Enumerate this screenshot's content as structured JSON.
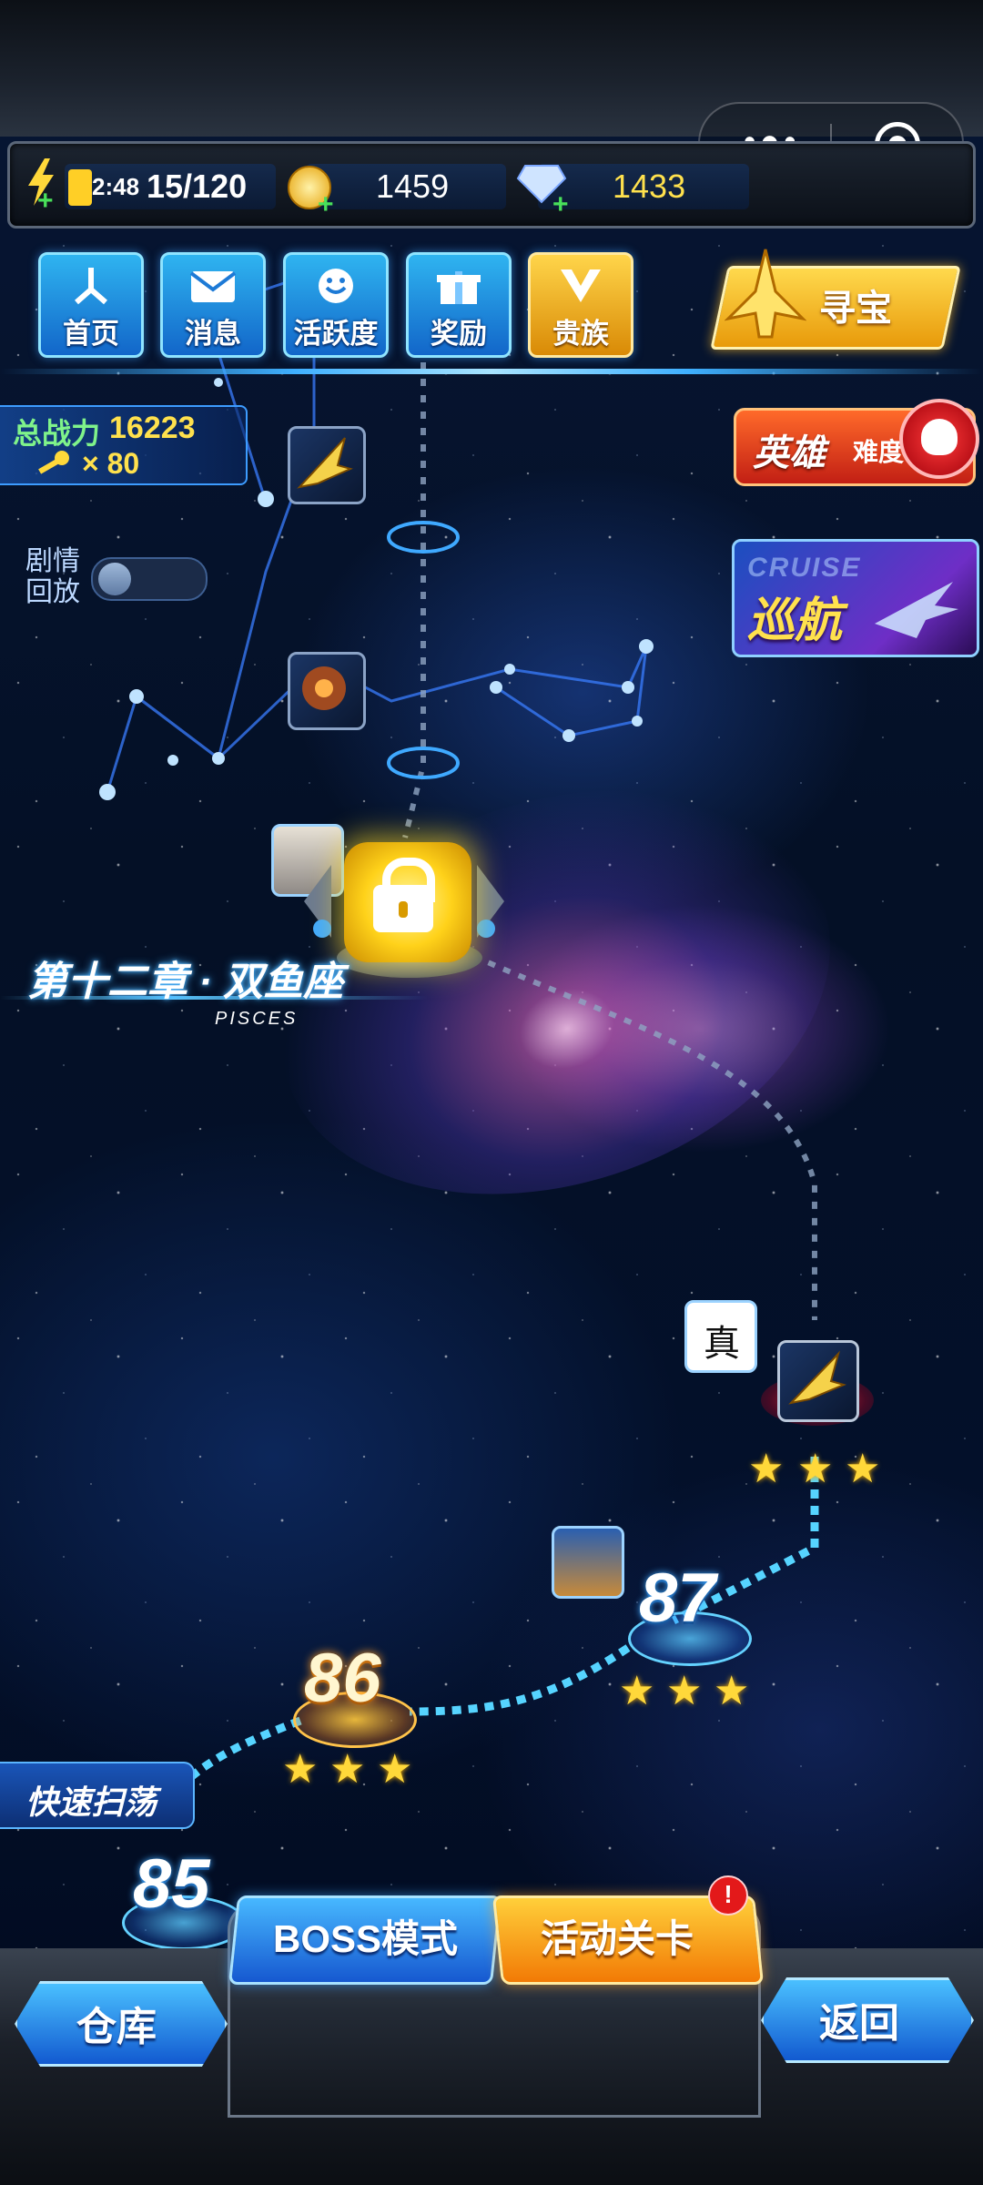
{
  "resources": {
    "energy_timer": "2:48",
    "energy": "15/120",
    "gold": "1459",
    "diamonds": "1433"
  },
  "capsule": {
    "menu_icon": "more-dots-icon",
    "close_icon": "target-icon"
  },
  "nav": [
    {
      "label": "首页",
      "icon": "home-icon"
    },
    {
      "label": "消息",
      "icon": "mail-icon"
    },
    {
      "label": "活跃度",
      "icon": "smile-icon"
    },
    {
      "label": "奖励",
      "icon": "gift-icon"
    },
    {
      "label": "贵族",
      "icon": "noble-crest-icon"
    }
  ],
  "treasure": {
    "label": "寻宝"
  },
  "player": {
    "power_label": "总战力",
    "power": "16223",
    "keys": "× 80"
  },
  "story": {
    "label": "剧情\n回放",
    "replay_enabled": false
  },
  "hero_difficulty": {
    "label_big": "英雄",
    "label_small": "难度"
  },
  "cruise": {
    "en": "CRUISE",
    "label": "巡航"
  },
  "chapter": {
    "title": "第十二章 · 双鱼座",
    "subtitle": "PISCES"
  },
  "stages": [
    {
      "number": "85",
      "stars": 3
    },
    {
      "number": "86",
      "stars": 3
    },
    {
      "number": "87",
      "stars": 3
    },
    {
      "number": "",
      "stars": 3
    }
  ],
  "quick_sweep": {
    "label": "快速扫荡"
  },
  "bottom": {
    "boss_label": "BOSS模式",
    "event_label": "活动关卡",
    "event_badge": "!",
    "warehouse_label": "仓库",
    "back_label": "返回"
  },
  "colors": {
    "accent_blue": "#2fb4f0",
    "gold": "#ffd83a",
    "power_green": "#7ff38a",
    "power_yellow": "#ffe14d"
  }
}
